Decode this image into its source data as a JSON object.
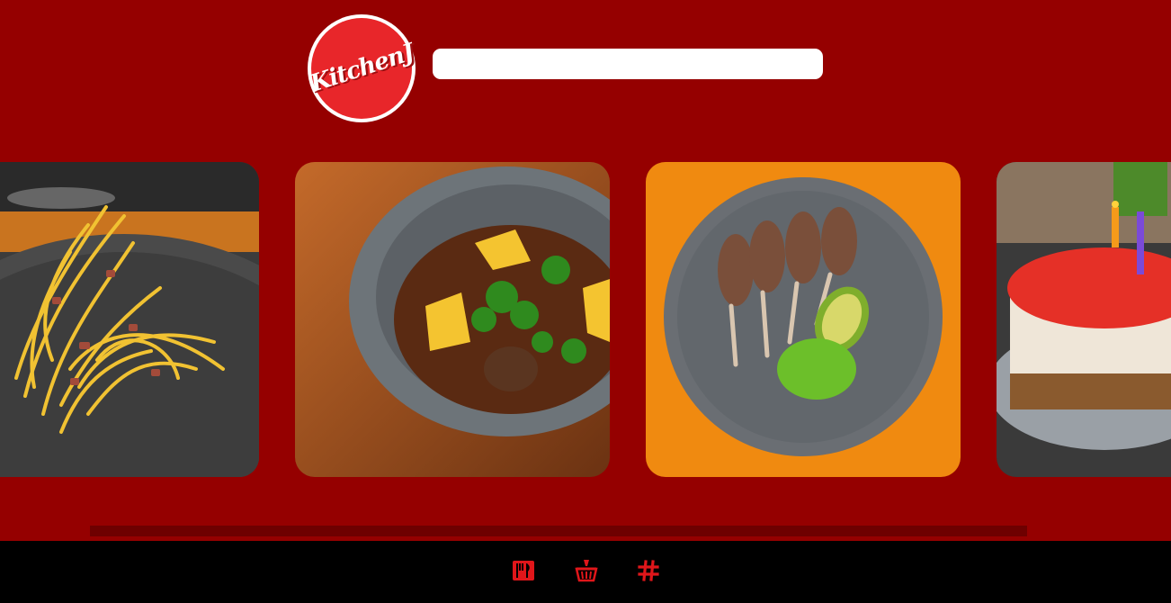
{
  "header": {
    "logo_text": "KitchenJ",
    "search": {
      "value": "",
      "placeholder": ""
    }
  },
  "colors": {
    "background": "#950000",
    "logo_red": "#e8262a",
    "bottom_bar": "#000000",
    "icon_red": "#e0161a"
  },
  "carousel": {
    "items": [
      {
        "name": "spaghetti-carbonara"
      },
      {
        "name": "beef-potato-stew"
      },
      {
        "name": "lamb-chops-avocado"
      },
      {
        "name": "strawberry-cheesecake"
      }
    ],
    "scroll_position": 0.0
  },
  "bottom_nav": {
    "items": [
      {
        "icon": "dining-icon"
      },
      {
        "icon": "basket-icon"
      },
      {
        "icon": "hashtag-icon"
      }
    ]
  }
}
